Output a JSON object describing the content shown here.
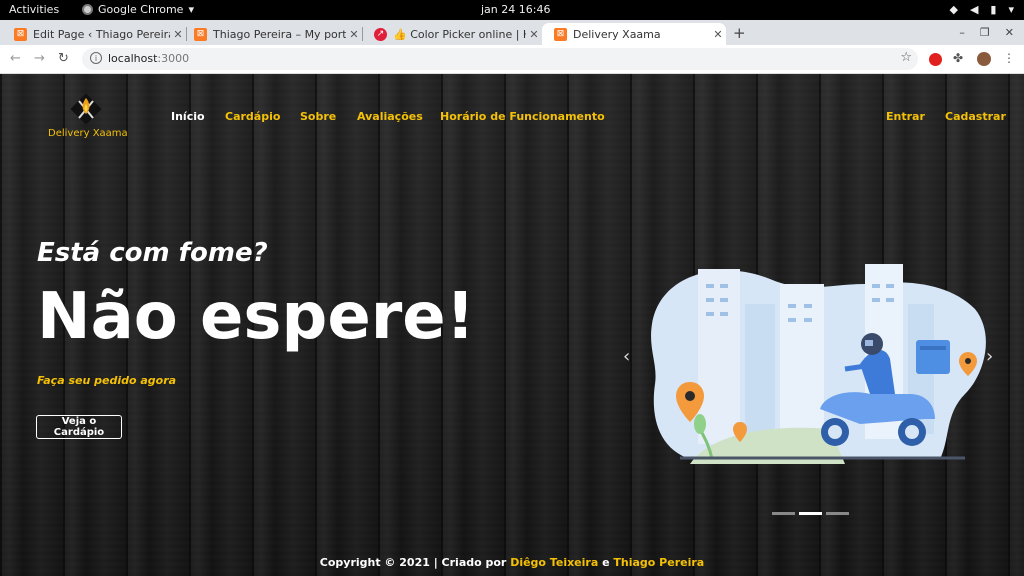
{
  "system": {
    "activities": "Activities",
    "app_name": "Google Chrome",
    "clock": "jan 24  16:46"
  },
  "browser": {
    "tabs": [
      {
        "title": "Edit Page ‹ Thiago Pereira",
        "favicon": "xampp-icon"
      },
      {
        "title": "Thiago Pereira – My portfo",
        "favicon": "xampp-icon"
      },
      {
        "title": "👍 Color Picker online | HT",
        "favicon": "color-picker-icon"
      },
      {
        "title": "Delivery Xaama",
        "favicon": "xampp-icon",
        "active": true
      }
    ],
    "url_host": "localhost",
    "url_port": ":3000"
  },
  "site": {
    "brand": "Delivery Xaama",
    "nav": {
      "home": "Início",
      "menu": "Cardápio",
      "about": "Sobre",
      "reviews": "Avaliações",
      "hours": "Horário de Funcionamento",
      "login": "Entrar",
      "signup": "Cadastrar"
    },
    "hero": {
      "question": "Está com fome?",
      "headline": "Não espere!",
      "subtitle": "Faça seu pedido agora",
      "cta": "Veja o Cardápio"
    },
    "carousel": {
      "slides": 3,
      "active_index": 1
    },
    "footer": {
      "prefix": "Copyright © 2021 | Criado por ",
      "author1": "Diêgo Teixeira",
      "conj": " e ",
      "author2": "Thiago Pereira"
    }
  },
  "colors": {
    "accent": "#f4c106",
    "text": "#ffffff",
    "background": "#1e1e1e"
  }
}
